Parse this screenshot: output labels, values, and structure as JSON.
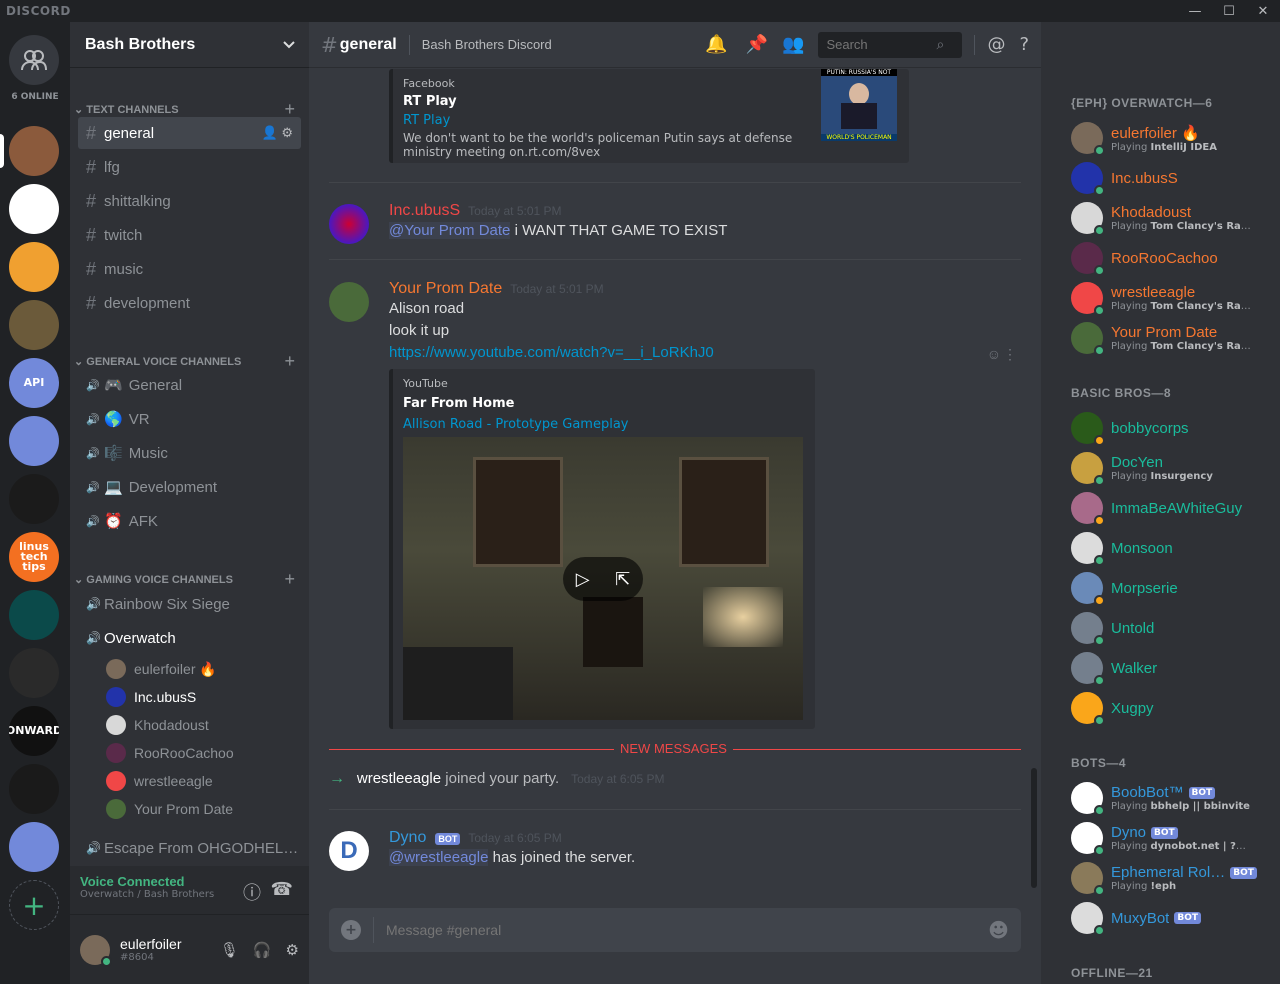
{
  "app": {
    "logo": "DISCORD"
  },
  "guilds": {
    "online": "6 ONLINE",
    "items": [
      {
        "name": "friends",
        "color": "#36393f"
      },
      {
        "name": "server-1",
        "color": "#8b5a3c"
      },
      {
        "name": "server-hello-kitty",
        "color": "#ffffff"
      },
      {
        "name": "server-explosion",
        "color": "#f0a030"
      },
      {
        "name": "server-zombie",
        "color": "#6b5a3a"
      },
      {
        "name": "server-api",
        "color": "#7289da",
        "text": "API"
      },
      {
        "name": "server-santa",
        "color": "#7289da"
      },
      {
        "name": "server-robot",
        "color": "#1b1b1b"
      },
      {
        "name": "server-linus",
        "color": "#f37021",
        "text": "linus tech tips"
      },
      {
        "name": "server-matrix",
        "color": "#0b4a4a"
      },
      {
        "name": "server-pixel",
        "color": "#2a2a2a"
      },
      {
        "name": "server-onward",
        "color": "#111111",
        "text": "ONWARD"
      },
      {
        "name": "server-eagle",
        "color": "#1a1a1a"
      },
      {
        "name": "server-anime",
        "color": "#7289da"
      }
    ]
  },
  "server": {
    "name": "Bash Brothers"
  },
  "categories": {
    "text": "TEXT CHANNELS",
    "general_voice": "GENERAL VOICE CHANNELS",
    "gaming_voice": "GAMING VOICE CHANNELS"
  },
  "text_channels": [
    "general",
    "lfg",
    "shittalking",
    "twitch",
    "music",
    "development"
  ],
  "general_voice": [
    {
      "icon": "🎮",
      "name": "General"
    },
    {
      "icon": "🌎",
      "name": "VR"
    },
    {
      "icon": "🎼",
      "name": "Music"
    },
    {
      "icon": "💻",
      "name": "Development"
    },
    {
      "icon": "⏰",
      "name": "AFK"
    }
  ],
  "gaming_voice": {
    "rainbow": "Rainbow Six Siege",
    "overwatch": "Overwatch",
    "escape": "Escape From OHGODHEL…",
    "users": [
      {
        "name": "eulerfoiler 🔥",
        "color": "#7a6a5a"
      },
      {
        "name": "Inc.ubusS",
        "color": "#2233aa"
      },
      {
        "name": "Khodadoust",
        "color": "#d8d8d8"
      },
      {
        "name": "RooRooCachoo",
        "color": "#5a2a4a"
      },
      {
        "name": "wrestleeagle",
        "color": "#f04747"
      },
      {
        "name": "Your Prom Date",
        "color": "#4a6a3a"
      }
    ]
  },
  "voice": {
    "status": "Voice Connected",
    "sub": "Overwatch / Bash Brothers"
  },
  "me": {
    "name": "eulerfoiler",
    "tag": "#8604"
  },
  "channel": {
    "name": "general",
    "topic": "Bash Brothers Discord",
    "search_placeholder": "Search"
  },
  "messages": {
    "embed1": {
      "provider": "Facebook",
      "title": "RT Play",
      "link": "RT Play",
      "desc": "We don't want to be the world's policeman Putin says at defense ministry meeting on.rt.com/8vex",
      "thumb_top": "PUTIN: RUSSIA'S NOT",
      "thumb_bottom": "WORLD'S POLICEMAN"
    },
    "m1": {
      "user": "Inc.ubusS",
      "time": "Today at 5:01 PM",
      "mention": "@Your Prom Date",
      "text": " i WANT THAT GAME TO EXIST"
    },
    "m2": {
      "user": "Your Prom Date",
      "time": "Today at 5:01 PM",
      "l1": "Alison road",
      "l2": "look it up",
      "url": "https://www.youtube.com/watch?v=__i_LoRKhJ0"
    },
    "embed2": {
      "provider": "YouTube",
      "title": "Far From Home",
      "link": "Allison Road - Prototype Gameplay"
    },
    "new_messages": "NEW MESSAGES",
    "party": {
      "user": "wrestleeagle",
      "text": " joined your party.",
      "time": "Today at 6:05 PM"
    },
    "m3": {
      "user": "Dyno",
      "bot": "BOT",
      "time": "Today at 6:05 PM",
      "mention": "@wrestleeagle",
      "text": " has joined the server."
    }
  },
  "composer": {
    "placeholder": "Message #general"
  },
  "members": {
    "g1": {
      "header": "{EPH} OVERWATCH—6",
      "items": [
        {
          "name": "eulerfoiler 🔥",
          "color": "#f57731",
          "act": "Playing ",
          "game": "IntelliJ IDEA",
          "av": "#7a6a5a",
          "st": "#43b581"
        },
        {
          "name": "Inc.ubusS",
          "color": "#f57731",
          "act": "",
          "game": "",
          "av": "#2233aa",
          "st": "#43b581"
        },
        {
          "name": "Khodadoust",
          "color": "#f57731",
          "act": "Playing ",
          "game": "Tom Clancy's Rainbo…",
          "av": "#d8d8d8",
          "st": "#43b581"
        },
        {
          "name": "RooRooCachoo",
          "color": "#f57731",
          "act": "",
          "game": "",
          "av": "#5a2a4a",
          "st": "#43b581"
        },
        {
          "name": "wrestleeagle",
          "color": "#f57731",
          "act": "Playing ",
          "game": "Tom Clancy's Rainbo…",
          "av": "#f04747",
          "st": "#43b581"
        },
        {
          "name": "Your Prom Date",
          "color": "#f57731",
          "act": "Playing ",
          "game": "Tom Clancy's Rainbo…",
          "av": "#4a6a3a",
          "st": "#43b581"
        }
      ]
    },
    "g2": {
      "header": "BASIC BROS—8",
      "items": [
        {
          "name": "bobbycorps",
          "color": "#1abc9c",
          "act": "",
          "game": "",
          "av": "#2a5a1a",
          "st": "#faa61a"
        },
        {
          "name": "DocYen",
          "color": "#1abc9c",
          "act": "Playing ",
          "game": "Insurgency",
          "av": "#c8a040",
          "st": "#43b581"
        },
        {
          "name": "ImmaBeAWhiteGuy",
          "color": "#1abc9c",
          "act": "",
          "game": "",
          "av": "#a86a8a",
          "st": "#faa61a"
        },
        {
          "name": "Monsoon",
          "color": "#1abc9c",
          "act": "",
          "game": "",
          "av": "#dcdcdc",
          "st": "#43b581"
        },
        {
          "name": "Morpserie",
          "color": "#1abc9c",
          "act": "",
          "game": "",
          "av": "#6a8ab8",
          "st": "#faa61a"
        },
        {
          "name": "Untold",
          "color": "#1abc9c",
          "act": "",
          "game": "",
          "av": "#747f8d",
          "st": "#43b581"
        },
        {
          "name": "Walker",
          "color": "#1abc9c",
          "act": "",
          "game": "",
          "av": "#747f8d",
          "st": "#43b581"
        },
        {
          "name": "Xugpy",
          "color": "#1abc9c",
          "act": "",
          "game": "",
          "av": "#faa61a",
          "st": "#43b581"
        }
      ]
    },
    "g3": {
      "header": "BOTS—4",
      "items": [
        {
          "name": "BoobBot™",
          "color": "#3498db",
          "bot": "BOT",
          "act": "Playing ",
          "game": "bbhelp || bbinvite",
          "av": "#ffffff",
          "st": "#43b581"
        },
        {
          "name": "Dyno",
          "color": "#3498db",
          "bot": "BOT",
          "act": "Playing ",
          "game": "dynobot.net | ?help",
          "av": "#ffffff",
          "st": "#43b581"
        },
        {
          "name": "Ephemeral Rol…",
          "color": "#3498db",
          "bot": "BOT",
          "act": "Playing ",
          "game": "!eph",
          "av": "#8a7a5a",
          "st": "#43b581"
        },
        {
          "name": "MuxyBot",
          "color": "#3498db",
          "bot": "BOT",
          "act": "",
          "game": "",
          "av": "#dcdcdc",
          "st": "#43b581"
        }
      ]
    },
    "offline": "OFFLINE—21"
  }
}
